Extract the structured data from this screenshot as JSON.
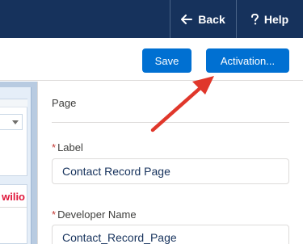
{
  "header": {
    "back_label": "Back",
    "help_label": "Help"
  },
  "toolbar": {
    "save_label": "Save",
    "activation_label": "Activation..."
  },
  "canvas": {
    "component_logo_text": "wilio"
  },
  "properties": {
    "section_title": "Page",
    "label_field": {
      "required_marker": "*",
      "label": "Label",
      "value": "Contact Record Page"
    },
    "developer_name_field": {
      "required_marker": "*",
      "label": "Developer Name",
      "value": "Contact_Record_Page"
    }
  },
  "colors": {
    "header_bg": "#16325c",
    "brand_button": "#0070d2",
    "required_marker": "#c23934",
    "annotation_arrow": "#e0372b",
    "logo_red": "#e0173b"
  },
  "icons": {
    "back": "left-arrow-icon",
    "help": "question-mark-icon",
    "picklist": "chevron-down-icon",
    "annotation": "arrow-pointer-icon"
  }
}
